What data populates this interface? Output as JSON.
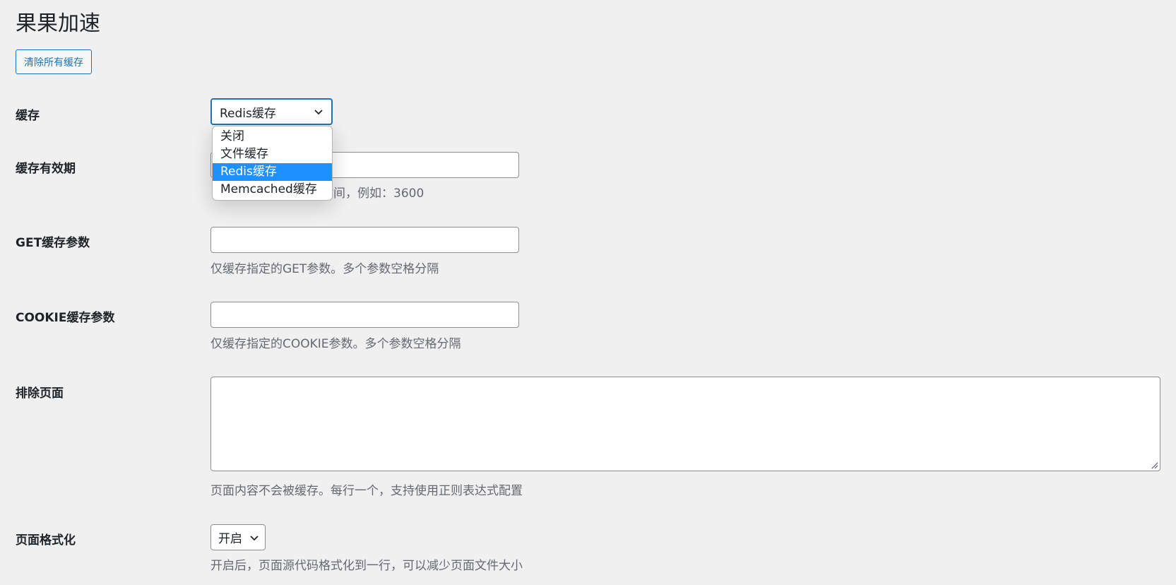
{
  "page": {
    "title": "果果加速"
  },
  "toolbar": {
    "clear_cache_label": "清除所有缓存"
  },
  "cache": {
    "label": "缓存",
    "selected": "Redis缓存",
    "options": [
      "关闭",
      "文件缓存",
      "Redis缓存",
      "Memcached缓存"
    ]
  },
  "cache_ttl": {
    "label": "缓存有效期",
    "value": "",
    "description": "时间，例如：3600"
  },
  "get_params": {
    "label": "GET缓存参数",
    "value": "",
    "description": "仅缓存指定的GET参数。多个参数空格分隔"
  },
  "cookie_params": {
    "label": "COOKIE缓存参数",
    "value": "",
    "description": "仅缓存指定的COOKIE参数。多个参数空格分隔"
  },
  "exclude_pages": {
    "label": "排除页面",
    "value": "",
    "description": "页面内容不会被缓存。每行一个，支持使用正则表达式配置"
  },
  "page_format": {
    "label": "页面格式化",
    "selected": "开启",
    "description": "开启后，页面源代码格式化到一行，可以减少页面文件大小"
  }
}
